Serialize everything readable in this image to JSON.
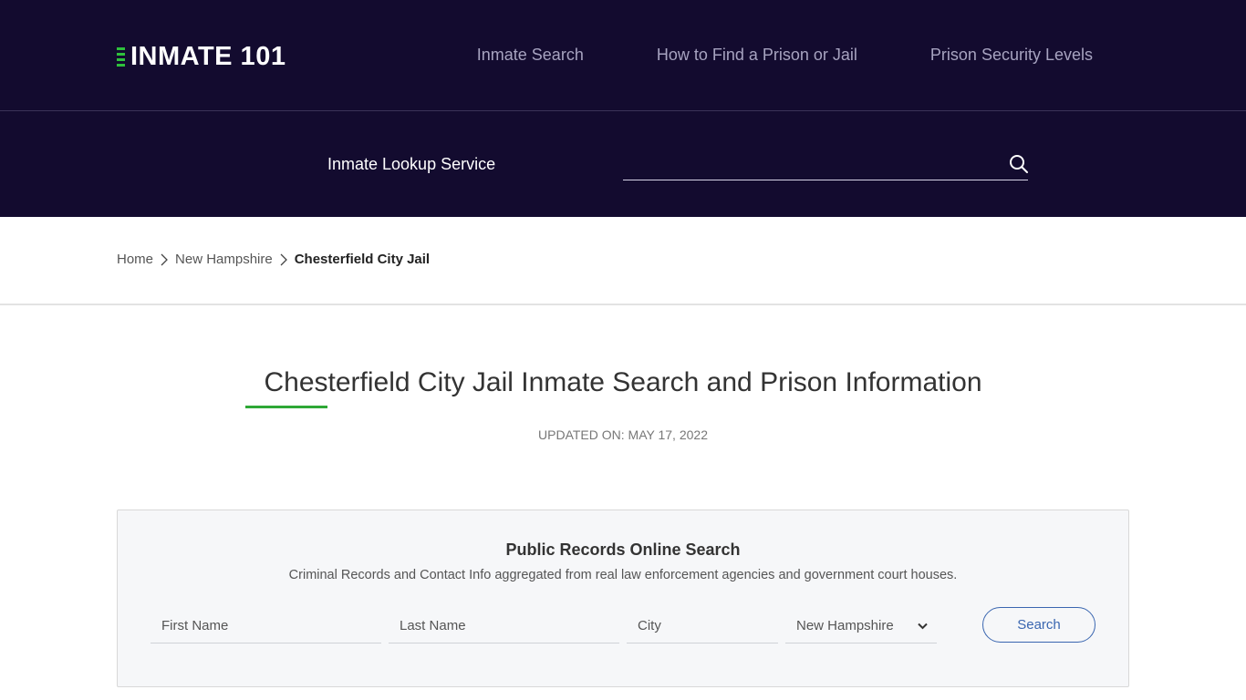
{
  "header": {
    "logo_text": "INMATE 101",
    "nav": [
      {
        "label": "Inmate Search"
      },
      {
        "label": "How to Find a Prison or Jail"
      },
      {
        "label": "Prison Security Levels"
      }
    ]
  },
  "lookup": {
    "label": "Inmate Lookup Service",
    "value": "",
    "icon": "search-icon"
  },
  "breadcrumb": [
    {
      "label": "Home"
    },
    {
      "label": "New Hampshire"
    },
    {
      "label": "Chesterfield City Jail"
    }
  ],
  "page": {
    "title": "Chesterfield City Jail Inmate Search and Prison Information",
    "updated": "UPDATED ON: MAY 17, 2022"
  },
  "records_search": {
    "title": "Public Records Online Search",
    "subtitle": "Criminal Records and Contact Info aggregated from real law enforcement agencies and government court houses.",
    "first_name_placeholder": "First Name",
    "last_name_placeholder": "Last Name",
    "city_placeholder": "City",
    "state_selected": "New Hampshire",
    "button_label": "Search"
  },
  "colors": {
    "header_bg": "#130b2f",
    "accent_green": "#2ec03c",
    "button_blue": "#3a66b0"
  }
}
